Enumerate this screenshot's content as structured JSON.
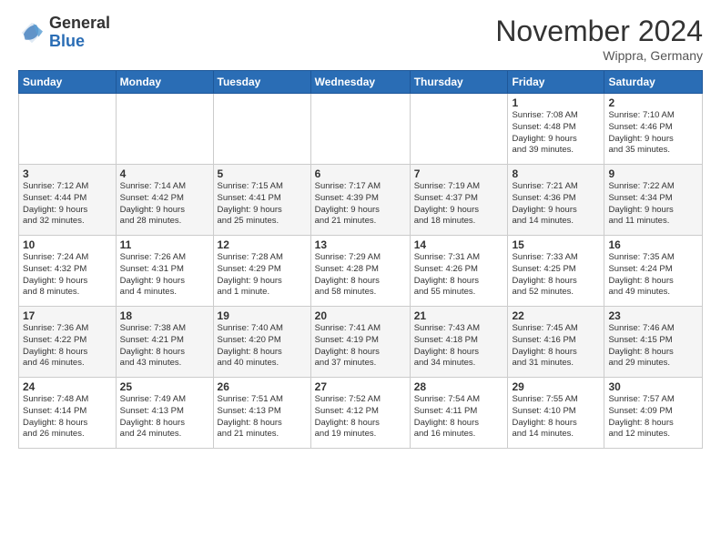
{
  "logo": {
    "general": "General",
    "blue": "Blue"
  },
  "header": {
    "month": "November 2024",
    "location": "Wippra, Germany"
  },
  "weekdays": [
    "Sunday",
    "Monday",
    "Tuesday",
    "Wednesday",
    "Thursday",
    "Friday",
    "Saturday"
  ],
  "weeks": [
    [
      {
        "day": "",
        "info": ""
      },
      {
        "day": "",
        "info": ""
      },
      {
        "day": "",
        "info": ""
      },
      {
        "day": "",
        "info": ""
      },
      {
        "day": "",
        "info": ""
      },
      {
        "day": "1",
        "info": "Sunrise: 7:08 AM\nSunset: 4:48 PM\nDaylight: 9 hours\nand 39 minutes."
      },
      {
        "day": "2",
        "info": "Sunrise: 7:10 AM\nSunset: 4:46 PM\nDaylight: 9 hours\nand 35 minutes."
      }
    ],
    [
      {
        "day": "3",
        "info": "Sunrise: 7:12 AM\nSunset: 4:44 PM\nDaylight: 9 hours\nand 32 minutes."
      },
      {
        "day": "4",
        "info": "Sunrise: 7:14 AM\nSunset: 4:42 PM\nDaylight: 9 hours\nand 28 minutes."
      },
      {
        "day": "5",
        "info": "Sunrise: 7:15 AM\nSunset: 4:41 PM\nDaylight: 9 hours\nand 25 minutes."
      },
      {
        "day": "6",
        "info": "Sunrise: 7:17 AM\nSunset: 4:39 PM\nDaylight: 9 hours\nand 21 minutes."
      },
      {
        "day": "7",
        "info": "Sunrise: 7:19 AM\nSunset: 4:37 PM\nDaylight: 9 hours\nand 18 minutes."
      },
      {
        "day": "8",
        "info": "Sunrise: 7:21 AM\nSunset: 4:36 PM\nDaylight: 9 hours\nand 14 minutes."
      },
      {
        "day": "9",
        "info": "Sunrise: 7:22 AM\nSunset: 4:34 PM\nDaylight: 9 hours\nand 11 minutes."
      }
    ],
    [
      {
        "day": "10",
        "info": "Sunrise: 7:24 AM\nSunset: 4:32 PM\nDaylight: 9 hours\nand 8 minutes."
      },
      {
        "day": "11",
        "info": "Sunrise: 7:26 AM\nSunset: 4:31 PM\nDaylight: 9 hours\nand 4 minutes."
      },
      {
        "day": "12",
        "info": "Sunrise: 7:28 AM\nSunset: 4:29 PM\nDaylight: 9 hours\nand 1 minute."
      },
      {
        "day": "13",
        "info": "Sunrise: 7:29 AM\nSunset: 4:28 PM\nDaylight: 8 hours\nand 58 minutes."
      },
      {
        "day": "14",
        "info": "Sunrise: 7:31 AM\nSunset: 4:26 PM\nDaylight: 8 hours\nand 55 minutes."
      },
      {
        "day": "15",
        "info": "Sunrise: 7:33 AM\nSunset: 4:25 PM\nDaylight: 8 hours\nand 52 minutes."
      },
      {
        "day": "16",
        "info": "Sunrise: 7:35 AM\nSunset: 4:24 PM\nDaylight: 8 hours\nand 49 minutes."
      }
    ],
    [
      {
        "day": "17",
        "info": "Sunrise: 7:36 AM\nSunset: 4:22 PM\nDaylight: 8 hours\nand 46 minutes."
      },
      {
        "day": "18",
        "info": "Sunrise: 7:38 AM\nSunset: 4:21 PM\nDaylight: 8 hours\nand 43 minutes."
      },
      {
        "day": "19",
        "info": "Sunrise: 7:40 AM\nSunset: 4:20 PM\nDaylight: 8 hours\nand 40 minutes."
      },
      {
        "day": "20",
        "info": "Sunrise: 7:41 AM\nSunset: 4:19 PM\nDaylight: 8 hours\nand 37 minutes."
      },
      {
        "day": "21",
        "info": "Sunrise: 7:43 AM\nSunset: 4:18 PM\nDaylight: 8 hours\nand 34 minutes."
      },
      {
        "day": "22",
        "info": "Sunrise: 7:45 AM\nSunset: 4:16 PM\nDaylight: 8 hours\nand 31 minutes."
      },
      {
        "day": "23",
        "info": "Sunrise: 7:46 AM\nSunset: 4:15 PM\nDaylight: 8 hours\nand 29 minutes."
      }
    ],
    [
      {
        "day": "24",
        "info": "Sunrise: 7:48 AM\nSunset: 4:14 PM\nDaylight: 8 hours\nand 26 minutes."
      },
      {
        "day": "25",
        "info": "Sunrise: 7:49 AM\nSunset: 4:13 PM\nDaylight: 8 hours\nand 24 minutes."
      },
      {
        "day": "26",
        "info": "Sunrise: 7:51 AM\nSunset: 4:13 PM\nDaylight: 8 hours\nand 21 minutes."
      },
      {
        "day": "27",
        "info": "Sunrise: 7:52 AM\nSunset: 4:12 PM\nDaylight: 8 hours\nand 19 minutes."
      },
      {
        "day": "28",
        "info": "Sunrise: 7:54 AM\nSunset: 4:11 PM\nDaylight: 8 hours\nand 16 minutes."
      },
      {
        "day": "29",
        "info": "Sunrise: 7:55 AM\nSunset: 4:10 PM\nDaylight: 8 hours\nand 14 minutes."
      },
      {
        "day": "30",
        "info": "Sunrise: 7:57 AM\nSunset: 4:09 PM\nDaylight: 8 hours\nand 12 minutes."
      }
    ]
  ]
}
